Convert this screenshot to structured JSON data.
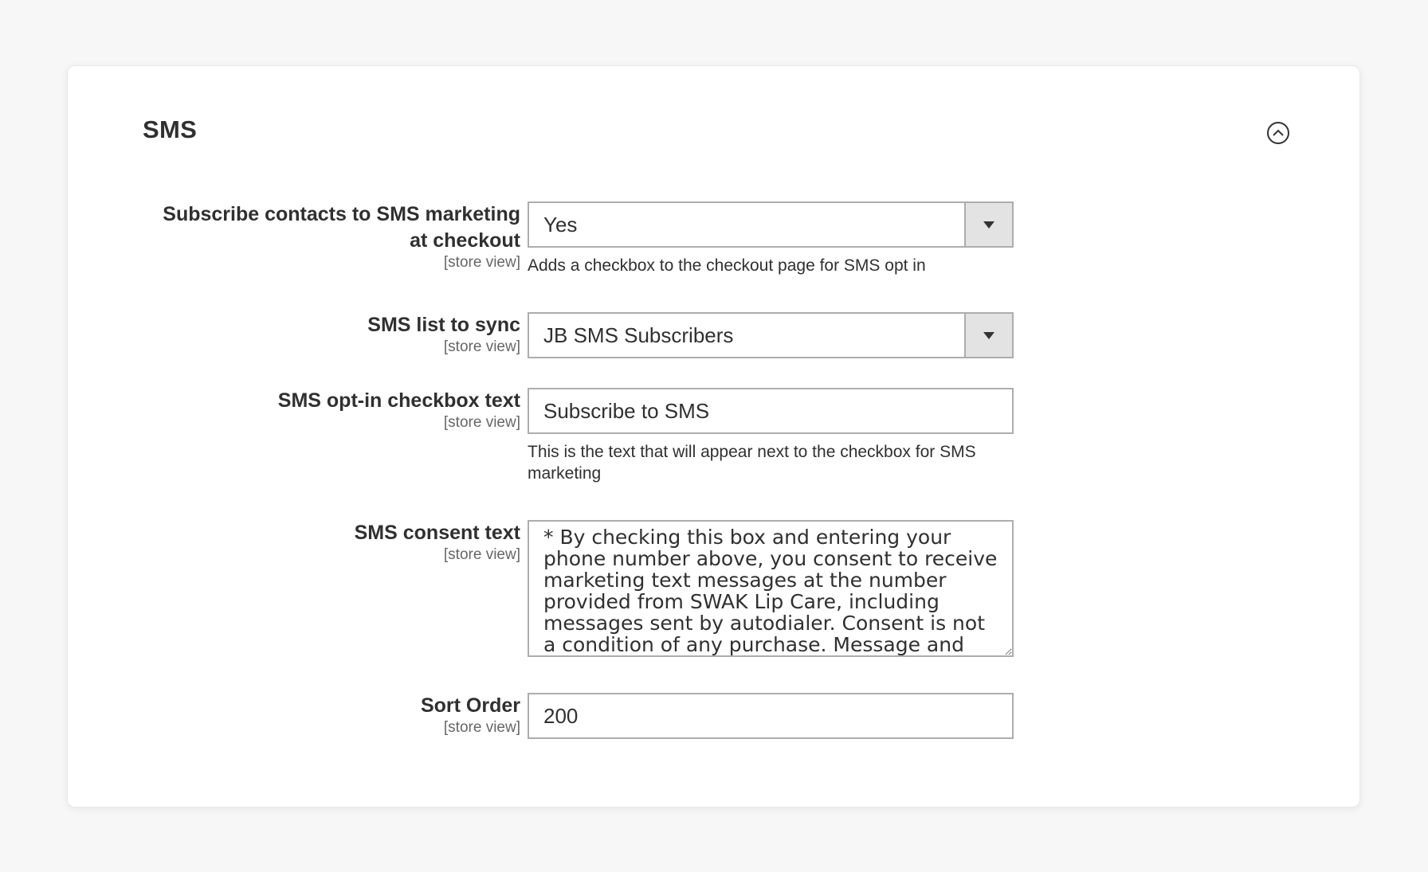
{
  "section": {
    "title": "SMS"
  },
  "fields": {
    "subscribe_checkout": {
      "label_line1": "Subscribe contacts to SMS marketing",
      "label_line2": "at checkout",
      "scope": "[store view]",
      "value": "Yes",
      "note": "Adds a checkbox to the checkout page for SMS opt in"
    },
    "sms_list": {
      "label": "SMS list to sync",
      "scope": "[store view]",
      "value": "JB SMS Subscribers"
    },
    "optin_text": {
      "label": "SMS opt-in checkbox text",
      "scope": "[store view]",
      "value": "Subscribe to SMS",
      "note": "This is the text that will appear next to the checkbox for SMS marketing"
    },
    "consent_text": {
      "label": "SMS consent text",
      "scope": "[store view]",
      "value": "* By checking this box and entering your phone number above, you consent to receive marketing text messages at the number provided from SWAK Lip Care, including messages sent by autodialer. Consent is not a condition of any purchase. Message and data rates may apply. Message"
    },
    "sort_order": {
      "label": "Sort Order",
      "scope": "[store view]",
      "value": "200"
    }
  }
}
